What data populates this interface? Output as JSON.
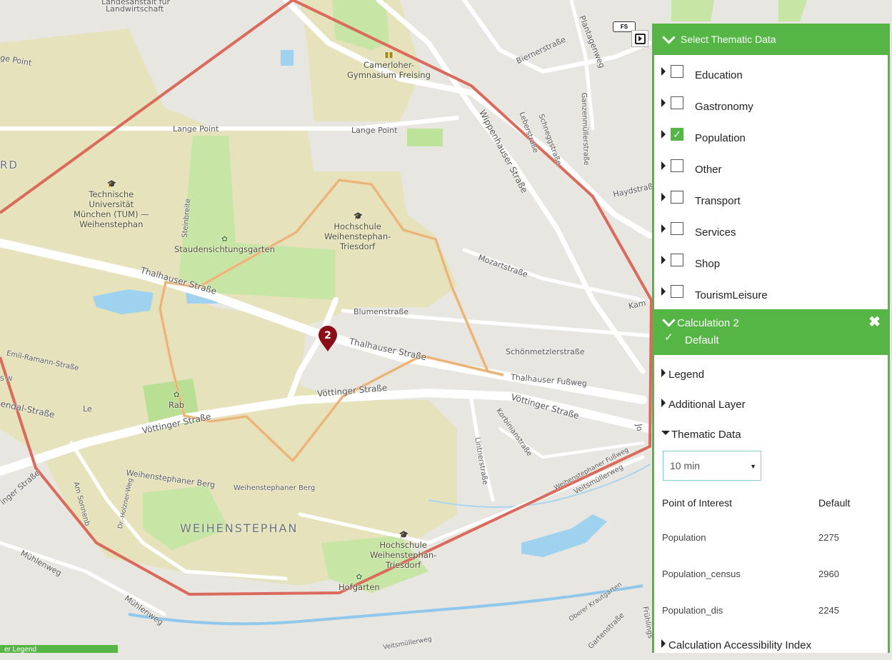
{
  "map": {
    "labels": [
      {
        "id": "lw",
        "text": "Landesanstalt für"
      },
      {
        "id": "lw2",
        "text": "Landwirtschaft"
      },
      {
        "id": "gepoint",
        "text": "ge Point"
      },
      {
        "id": "langepoint1",
        "text": "Lange Point"
      },
      {
        "id": "langepoint2",
        "text": "Lange Point"
      },
      {
        "id": "rd",
        "text": "RD"
      },
      {
        "id": "biernerstr",
        "text": "Biernerstraße"
      },
      {
        "id": "plantagenweg",
        "text": "Plantagenweg"
      },
      {
        "id": "wippenhauser",
        "text": "Wippenhauser Straße"
      },
      {
        "id": "leberstr",
        "text": "Leberstraße"
      },
      {
        "id": "schneggstr",
        "text": "Schneggstraße"
      },
      {
        "id": "ganzenmueller",
        "text": "Ganzenmüllerstraße"
      },
      {
        "id": "haydstr",
        "text": "Haydstraß"
      },
      {
        "id": "steinbreite",
        "text": "Steinbreite"
      },
      {
        "id": "mozartstr",
        "text": "Mozartstraße"
      },
      {
        "id": "kam",
        "text": "Kam"
      },
      {
        "id": "thalhauser1",
        "text": "Thalhauser Straße"
      },
      {
        "id": "thalhauser2",
        "text": "Thalhauser Straße"
      },
      {
        "id": "blumenstr",
        "text": "Blumenstraße"
      },
      {
        "id": "schoenmetzler",
        "text": "Schönmetzlerstraße"
      },
      {
        "id": "thalhauserfussweg",
        "text": "Thalhauser Fußweg"
      },
      {
        "id": "emilramann",
        "text": "Emil-Ramann-Straße"
      },
      {
        "id": "endal",
        "text": "endal-Straße"
      },
      {
        "id": "le",
        "text": "Le"
      },
      {
        "id": "voettinger1",
        "text": "Vöttinger Straße"
      },
      {
        "id": "voettinger2",
        "text": "Vöttinger Straße"
      },
      {
        "id": "voettinger3",
        "text": "Vöttinger Straße"
      },
      {
        "id": "korbinian",
        "text": "Korbinianstraße"
      },
      {
        "id": "lintner",
        "text": "Lintnerstraße"
      },
      {
        "id": "jo",
        "text": "Jo"
      },
      {
        "id": "weihenstephanerfussweg",
        "text": "Weihenstephaner Fußweg"
      },
      {
        "id": "veitsmueller",
        "text": "Veitsmüllerweg"
      },
      {
        "id": "ingerstr",
        "text": "inger Straße"
      },
      {
        "id": "amsonnen",
        "text": "Am Sonnenb"
      },
      {
        "id": "drholzner",
        "text": "Dr.-Holzner-Weg"
      },
      {
        "id": "weihenstephanerberg1",
        "text": "Weihenstephaner Berg"
      },
      {
        "id": "weihenstephanerberg2",
        "text": "Weihenstephaner Berg"
      },
      {
        "id": "muehlenweg1",
        "text": "Mühlenweg"
      },
      {
        "id": "muehlenweg2",
        "text": "Mühlenweg"
      },
      {
        "id": "oberer",
        "text": "Oberer Krautgarten"
      },
      {
        "id": "gartenstr",
        "text": "Gartenstraße"
      },
      {
        "id": "fruehling",
        "text": "Frühlings"
      },
      {
        "id": "veitsmueller2",
        "text": "Veitsmüllerweg"
      },
      {
        "id": "stw",
        "text": "S W"
      }
    ],
    "pois": [
      {
        "id": "camerloher",
        "lines": [
          "Camerloher-",
          "Gymnasium Freising"
        ]
      },
      {
        "id": "tum",
        "lines": [
          "Technische",
          "Universität",
          "München (TUM) —",
          "Weihenstephan"
        ]
      },
      {
        "id": "hochschule1",
        "lines": [
          "Hochschule",
          "Weihenstephan-",
          "Triesdorf"
        ]
      },
      {
        "id": "staudengarten",
        "lines": [
          "Staudensichtungsgarten"
        ]
      },
      {
        "id": "hochschule2",
        "lines": [
          "Hochschule",
          "Weihenstephan-",
          "Triesdorf"
        ]
      },
      {
        "id": "hgarten",
        "lines": [
          "Hofgarten"
        ]
      },
      {
        "id": "rab",
        "lines": [
          "Rab"
        ]
      }
    ],
    "district": "WEIHENSTEPHAN",
    "marker_number": "2",
    "fs_badge": "FS",
    "colors": {
      "outer_isochrone": "#d96a5c",
      "inner_isochrone": "#f2c28a",
      "marker": "#8b0d17",
      "accent": "#55b646"
    }
  },
  "panel": {
    "header": "Select Thematic Data",
    "themes": [
      {
        "label": "Education",
        "checked": false
      },
      {
        "label": "Gastronomy",
        "checked": false
      },
      {
        "label": "Population",
        "checked": true
      },
      {
        "label": "Other",
        "checked": false
      },
      {
        "label": "Transport",
        "checked": false
      },
      {
        "label": "Services",
        "checked": false
      },
      {
        "label": "Shop",
        "checked": false
      },
      {
        "label": "TourismLeisure",
        "checked": false
      }
    ],
    "calc": {
      "title": "Calculation 2",
      "subtitle": "Default",
      "close": "✖",
      "check": "✓"
    },
    "sections": {
      "legend": "Legend",
      "additional_layer": "Additional Layer",
      "thematic_data": "Thematic Data",
      "accessibility": "Calculation Accessibility Index"
    },
    "select": {
      "value": "10 min",
      "arrow": "▼"
    },
    "table": {
      "headers": [
        "Point of Interest",
        "Default"
      ],
      "rows": [
        {
          "name": "Population",
          "value": "2275"
        },
        {
          "name": "Population_census",
          "value": "2960"
        },
        {
          "name": "Population_dis",
          "value": "2245"
        }
      ]
    }
  },
  "bottom_bar": "er Legend"
}
